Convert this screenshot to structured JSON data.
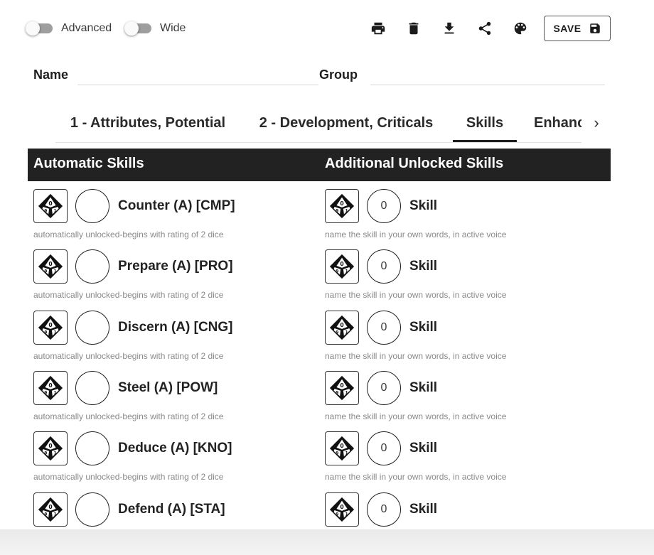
{
  "toolbar": {
    "advanced_label": "Advanced",
    "wide_label": "Wide",
    "save_label": "SAVE",
    "icons": [
      "print-icon",
      "trash-icon",
      "download-icon",
      "share-icon",
      "palette-icon",
      "floppy-disk-icon"
    ]
  },
  "form": {
    "name_label": "Name",
    "name_value": "",
    "group_label": "Group",
    "group_value": ""
  },
  "tabs": [
    {
      "label": "1 - Attributes, Potential",
      "active": false
    },
    {
      "label": "2 - Development, Criticals",
      "active": false
    },
    {
      "label": "Skills",
      "active": true
    },
    {
      "label": "Enhanc",
      "active": false
    }
  ],
  "tab_scroll_glyph": "›",
  "section": {
    "automatic_title": "Automatic Skills",
    "additional_title": "Additional Unlocked Skills"
  },
  "dice_face": {
    "top": "0",
    "left": "9",
    "right": "1",
    "bottom": "8"
  },
  "automatic_skills": [
    {
      "name": "Counter (A) [CMP]",
      "rating": "",
      "hint": "automatically unlocked-begins with rating of 2 dice"
    },
    {
      "name": "Prepare (A) [PRO]",
      "rating": "",
      "hint": "automatically unlocked-begins with rating of 2 dice"
    },
    {
      "name": "Discern (A) [CNG]",
      "rating": "",
      "hint": "automatically unlocked-begins with rating of 2 dice"
    },
    {
      "name": "Steel (A) [POW]",
      "rating": "",
      "hint": "automatically unlocked-begins with rating of 2 dice"
    },
    {
      "name": "Deduce (A) [KNO]",
      "rating": "",
      "hint": "automatically unlocked-begins with rating of 2 dice"
    },
    {
      "name": "Defend (A) [STA]",
      "rating": "",
      "hint": ""
    }
  ],
  "additional_skills": [
    {
      "name": "Skill",
      "rating": "0",
      "hint": "name the skill in your own words, in active voice"
    },
    {
      "name": "Skill",
      "rating": "0",
      "hint": "name the skill in your own words, in active voice"
    },
    {
      "name": "Skill",
      "rating": "0",
      "hint": "name the skill in your own words, in active voice"
    },
    {
      "name": "Skill",
      "rating": "0",
      "hint": "name the skill in your own words, in active voice"
    },
    {
      "name": "Skill",
      "rating": "0",
      "hint": "name the skill in your own words, in active voice"
    },
    {
      "name": "Skill",
      "rating": "0",
      "hint": ""
    }
  ]
}
